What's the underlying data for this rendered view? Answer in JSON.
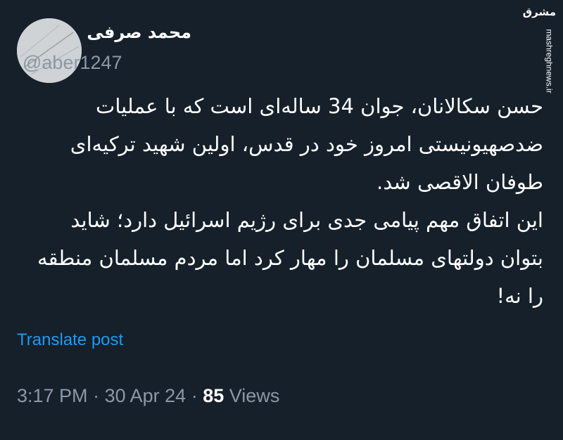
{
  "user": {
    "display_name": "محمد صرفی",
    "handle": "@aber1247"
  },
  "watermark": {
    "logo_text": "مشرق",
    "url": "mashreghnews.ir"
  },
  "tweet": {
    "lines": [
      "حسن سکالانان، جوان 34 ساله‌ای است که با عملیات",
      "ضدصهیونیستی امروز خود در قدس، اولین شهید ترکیه‌ای",
      "طوفان الاقصی شد.",
      "این اتفاق مهم پیامی جدی برای رژیم اسرائیل دارد؛ شاید",
      "بتوان دولتهای مسلمان را مهار کرد اما مردم مسلمان منطقه",
      "را نه!"
    ],
    "translate_label": "Translate post"
  },
  "meta": {
    "time": "3:17 PM",
    "separator": "·",
    "date": "30 Apr 24",
    "views_count": "85",
    "views_label": "Views"
  },
  "colors": {
    "background": "#15202b",
    "text": "#ffffff",
    "secondary": "#8b98a5",
    "link": "#1d9bf0"
  }
}
